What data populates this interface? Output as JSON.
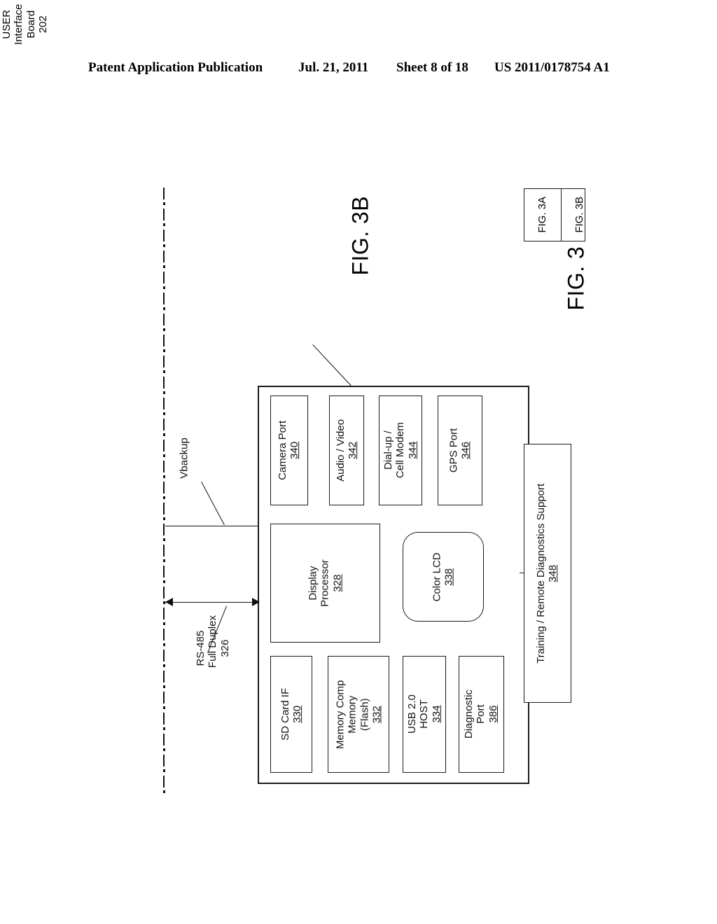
{
  "header": {
    "publication": "Patent Application Publication",
    "date": "Jul. 21, 2011",
    "sheet": "Sheet 8 of 18",
    "patent_number": "US 2011/0178754 A1"
  },
  "figure": {
    "title": "FIG. 3B",
    "key_title": "FIG. 3",
    "key_cells": [
      "FIG. 3A",
      "FIG. 3B"
    ],
    "board_label": {
      "line1": "USER",
      "line2": "Interface",
      "line3": "Board",
      "ref": "202"
    }
  },
  "signals": [
    {
      "name": "Vbackup",
      "ref": "",
      "arrow": "line"
    },
    {
      "name_line1": "RS-485",
      "name_line2": "Full Duplex",
      "ref": "326",
      "arrow": "double"
    }
  ],
  "blocks": {
    "camera_port": {
      "line1": "Camera Port",
      "ref": "340"
    },
    "audio_video": {
      "line1": "Audio / Video",
      "ref": "342"
    },
    "modem": {
      "line1": "Dial-up /",
      "line2": "Cell Modem",
      "ref": "344"
    },
    "gps_port": {
      "line1": "GPS Port",
      "ref": "346"
    },
    "display_processor": {
      "line1": "Display",
      "line2": "Processor",
      "ref": "328"
    },
    "color_lcd": {
      "line1": "Color LCD",
      "ref": "338"
    },
    "sd_card": {
      "line1": "SD Card IF",
      "ref": "330"
    },
    "memory": {
      "line1": "Memory Comp",
      "line2": "Memory",
      "line3": "(Flash)",
      "ref": "332"
    },
    "usb_host": {
      "line1": "USB 2.0",
      "line2": "HOST",
      "ref": "334"
    },
    "diagnostic_port": {
      "line1": "Diagnostic",
      "line2": "Port",
      "ref": "386"
    },
    "training": {
      "line1": "Training / Remote Diagnostics Support",
      "ref": "348"
    }
  },
  "colors": {
    "ink": "#111111",
    "paper": "#ffffff"
  }
}
